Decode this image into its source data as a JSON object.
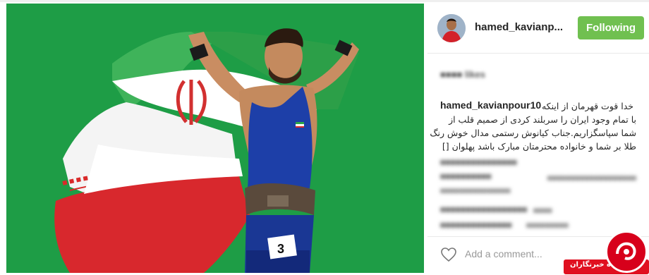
{
  "post": {
    "username": "hamed_kavianp...",
    "follow_label": "Following",
    "caption_username": "hamed_kavianpour10",
    "caption_lines": [
      "خدا قوت قهرمان از اینکه",
      "با تمام وجود ایران را سربلند کردی از صمیم قلب از",
      "شما سپاسگزاریم.جناب کیانوش رستمی مدال خوش رنگ",
      "طلا بر شما و خانواده محترمتان مبارک باشد پهلوان []"
    ],
    "add_comment_placeholder": "Add a comment...",
    "more_label": "···"
  },
  "photo": {
    "bib_number": "3"
  },
  "colors": {
    "follow": "#70c050",
    "background_green": "#1f9a45",
    "flag_green": "#2aa64a",
    "flag_red": "#d92a2a",
    "singlet_blue": "#1d3fa8"
  },
  "watermark": {
    "text": "باشگاه خبرنگاران"
  }
}
